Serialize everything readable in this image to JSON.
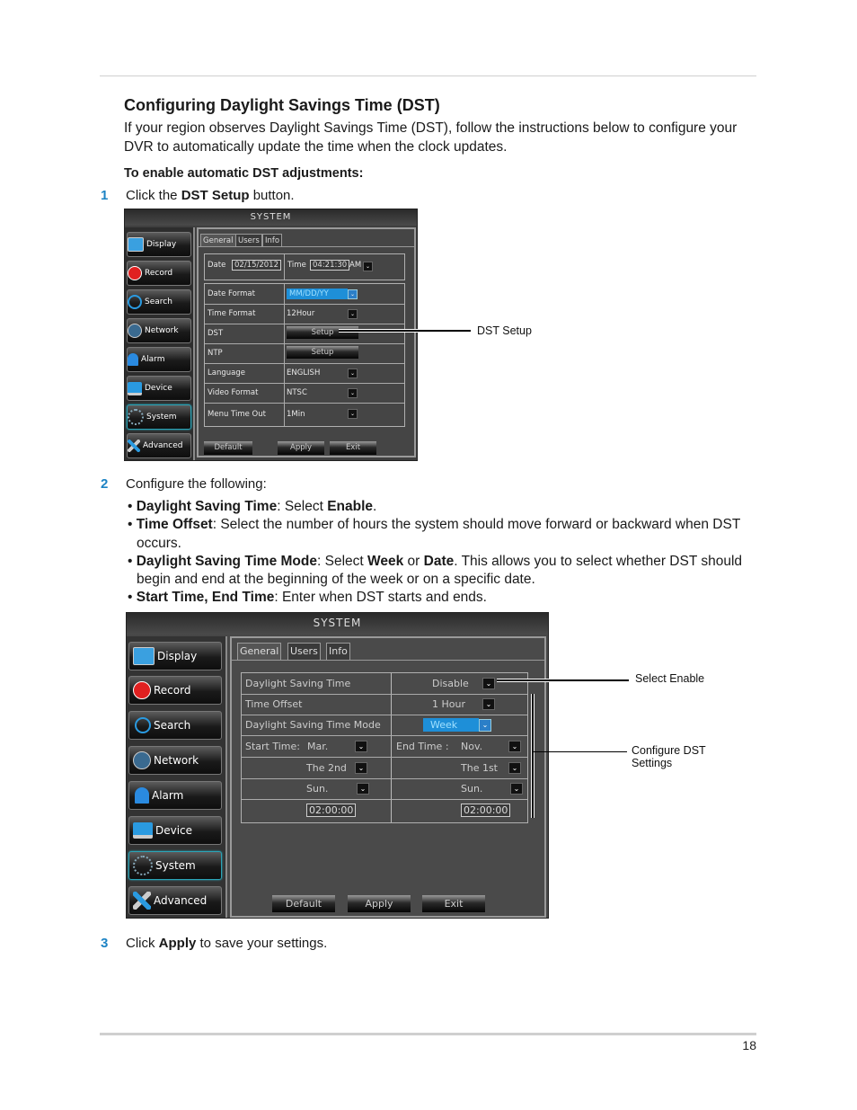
{
  "page": {
    "title": "Configuring Daylight Savings Time (DST)",
    "intro": "If your region observes Daylight Savings Time (DST), follow the instructions below to configure your DVR to automatically update the time when the clock updates.",
    "subheading": "To enable automatic DST adjustments:",
    "page_number": "18",
    "accent_color": "#1c83c4"
  },
  "steps": [
    {
      "num": "1",
      "pre": "Click the ",
      "bold": "DST Setup",
      "post": " button."
    },
    {
      "num": "2",
      "text": "Configure the following:"
    },
    {
      "num": "3",
      "pre": "Click ",
      "bold": "Apply",
      "post": " to save your settings."
    }
  ],
  "bullets": [
    {
      "b1": "Daylight Saving Time",
      "t1": ": Select ",
      "b2": "Enable",
      "t2": "."
    },
    {
      "b1": "Time Offset",
      "t1": ": Select the number of hours the system should move forward or backward when DST occurs.",
      "b2": "",
      "t2": ""
    },
    {
      "b1": "Daylight Saving Time Mode",
      "t1": ": Select ",
      "b2": "Week",
      "t2": " or ",
      "b3": "Date",
      "t3": ". This allows you to select whether DST should begin and end at the beginning of the week or on a specific date."
    },
    {
      "b1": "Start Time, End Time",
      "t1": ": Enter when DST starts and ends.",
      "b2": "",
      "t2": ""
    }
  ],
  "screen1": {
    "header": "SYSTEM",
    "nav": [
      {
        "label": "Display",
        "icon": "monitor-icon"
      },
      {
        "label": "Record",
        "icon": "record-icon"
      },
      {
        "label": "Search",
        "icon": "magnifier-icon"
      },
      {
        "label": "Network",
        "icon": "globe-icon"
      },
      {
        "label": "Alarm",
        "icon": "alarm-icon"
      },
      {
        "label": "Device",
        "icon": "device-icon"
      },
      {
        "label": "System",
        "icon": "gears-icon",
        "active": true
      },
      {
        "label": "Advanced",
        "icon": "tools-icon"
      }
    ],
    "tabs": [
      "General",
      "Users",
      "Info"
    ],
    "date_label": "Date",
    "date_value": "02/15/2012",
    "time_label": "Time",
    "time_value": "04:21:30",
    "ampm": "AM",
    "rows": [
      {
        "label": "Date Format",
        "value": "MM/DD/YY",
        "type": "select-highlight"
      },
      {
        "label": "Time Format",
        "value": "12Hour",
        "type": "select"
      },
      {
        "label": "DST",
        "value": "Setup",
        "type": "button"
      },
      {
        "label": "NTP",
        "value": "Setup",
        "type": "button"
      },
      {
        "label": "Language",
        "value": "ENGLISH",
        "type": "select"
      },
      {
        "label": "Video Format",
        "value": "NTSC",
        "type": "select"
      },
      {
        "label": "Menu Time Out",
        "value": "1Min",
        "type": "select"
      }
    ],
    "buttons": [
      "Default",
      "Apply",
      "Exit"
    ],
    "callout": "DST Setup"
  },
  "screen2": {
    "header": "SYSTEM",
    "nav": [
      {
        "label": "Display",
        "icon": "monitor-icon"
      },
      {
        "label": "Record",
        "icon": "record-icon"
      },
      {
        "label": "Search",
        "icon": "magnifier-icon"
      },
      {
        "label": "Network",
        "icon": "globe-icon"
      },
      {
        "label": "Alarm",
        "icon": "alarm-icon"
      },
      {
        "label": "Device",
        "icon": "device-icon"
      },
      {
        "label": "System",
        "icon": "gears-icon",
        "active": true
      },
      {
        "label": "Advanced",
        "icon": "tools-icon"
      }
    ],
    "tabs": [
      "General",
      "Users",
      "Info"
    ],
    "dst_label": "Daylight Saving Time",
    "dst_value": "Disable",
    "offset_label": "Time Offset",
    "offset_value": "1 Hour",
    "mode_label": "Daylight Saving Time Mode",
    "mode_value": "Week",
    "start_label": "Start Time:",
    "start_month": "Mar.",
    "end_label": "End Time :",
    "end_month": "Nov.",
    "start_week": "The 2nd",
    "end_week": "The 1st",
    "start_day": "Sun.",
    "end_day": "Sun.",
    "start_time": "02:00:00",
    "end_time": "02:00:00",
    "buttons": [
      "Default",
      "Apply",
      "Exit"
    ],
    "callout_enable": "Select Enable",
    "callout_settings_1": "Configure DST",
    "callout_settings_2": "Settings"
  }
}
